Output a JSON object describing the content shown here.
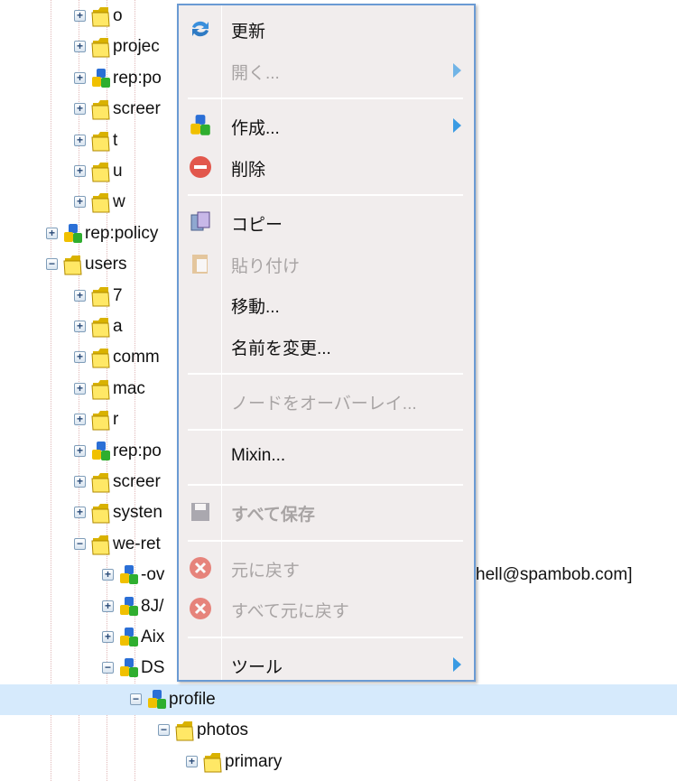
{
  "tree": [
    {
      "label": "o",
      "level": 2,
      "type": "folder",
      "state": "collapsed"
    },
    {
      "label": "projec",
      "level": 2,
      "type": "folder",
      "state": "collapsed"
    },
    {
      "label": "rep:po",
      "level": 2,
      "type": "node",
      "state": "collapsed"
    },
    {
      "label": "screer",
      "level": 2,
      "type": "folder",
      "state": "collapsed"
    },
    {
      "label": "t",
      "level": 2,
      "type": "folder",
      "state": "collapsed"
    },
    {
      "label": "u",
      "level": 2,
      "type": "folder",
      "state": "collapsed"
    },
    {
      "label": "w",
      "level": 2,
      "type": "folder",
      "state": "collapsed"
    },
    {
      "label": "rep:policy",
      "level": 1,
      "type": "node",
      "state": "collapsed"
    },
    {
      "label": "users",
      "level": 1,
      "type": "folder",
      "state": "expanded"
    },
    {
      "label": "7",
      "level": 2,
      "type": "folder",
      "state": "collapsed"
    },
    {
      "label": "a",
      "level": 2,
      "type": "folder",
      "state": "collapsed"
    },
    {
      "label": "comm",
      "level": 2,
      "type": "folder",
      "state": "collapsed"
    },
    {
      "label": "mac",
      "level": 2,
      "type": "folder",
      "state": "collapsed"
    },
    {
      "label": "r",
      "level": 2,
      "type": "folder",
      "state": "collapsed"
    },
    {
      "label": "rep:po",
      "level": 2,
      "type": "node",
      "state": "collapsed"
    },
    {
      "label": "screer",
      "level": 2,
      "type": "folder",
      "state": "collapsed"
    },
    {
      "label": "systen",
      "level": 2,
      "type": "folder",
      "state": "collapsed"
    },
    {
      "label": "we-ret",
      "level": 2,
      "type": "folder",
      "state": "expanded"
    },
    {
      "label": "-ov",
      "level": 3,
      "type": "node",
      "state": "collapsed"
    },
    {
      "label": "8J/",
      "level": 3,
      "type": "node",
      "state": "collapsed"
    },
    {
      "label": "Aix",
      "level": 3,
      "type": "node",
      "state": "collapsed"
    },
    {
      "label": "DS",
      "level": 3,
      "type": "node",
      "state": "expanded"
    },
    {
      "label": "profile",
      "level": 4,
      "type": "node",
      "state": "expanded",
      "selected": true
    },
    {
      "label": "photos",
      "level": 5,
      "type": "folder",
      "state": "expanded"
    },
    {
      "label": "primary",
      "level": 6,
      "type": "folder",
      "state": "collapsed"
    }
  ],
  "email_fragment": "hell@spambob.com]",
  "menu": [
    {
      "label": "更新",
      "icon": "refresh-icon",
      "disabled": false
    },
    {
      "label": "開く...",
      "disabled": true,
      "submenu": true
    },
    {
      "sep": true
    },
    {
      "label": "作成...",
      "icon": "node-icon",
      "disabled": false,
      "submenu": true
    },
    {
      "label": "削除",
      "icon": "delete-icon",
      "disabled": false
    },
    {
      "sep": true
    },
    {
      "label": "コピー",
      "icon": "copy-icon",
      "disabled": false
    },
    {
      "label": "貼り付け",
      "icon": "paste-icon",
      "disabled": true
    },
    {
      "label": "移動...",
      "disabled": false
    },
    {
      "label": "名前を変更...",
      "disabled": false
    },
    {
      "sep": true
    },
    {
      "label": "ノードをオーバーレイ...",
      "disabled": true
    },
    {
      "sep": true
    },
    {
      "label": "Mixin...",
      "disabled": false
    },
    {
      "sep": true
    },
    {
      "label": "すべて保存",
      "icon": "save-icon",
      "disabled": true,
      "bold": true
    },
    {
      "sep": true
    },
    {
      "label": "元に戻す",
      "icon": "revert-icon",
      "disabled": true
    },
    {
      "label": "すべて元に戻す",
      "icon": "revert-all-icon",
      "disabled": true
    },
    {
      "sep": true
    },
    {
      "label": "ツール",
      "disabled": false,
      "submenu": true
    }
  ],
  "colors": {
    "selection": "#d6eafc",
    "menu_border": "#6a9ad3",
    "menu_bg": "#f1eded",
    "arrow": "#3a9be3"
  }
}
